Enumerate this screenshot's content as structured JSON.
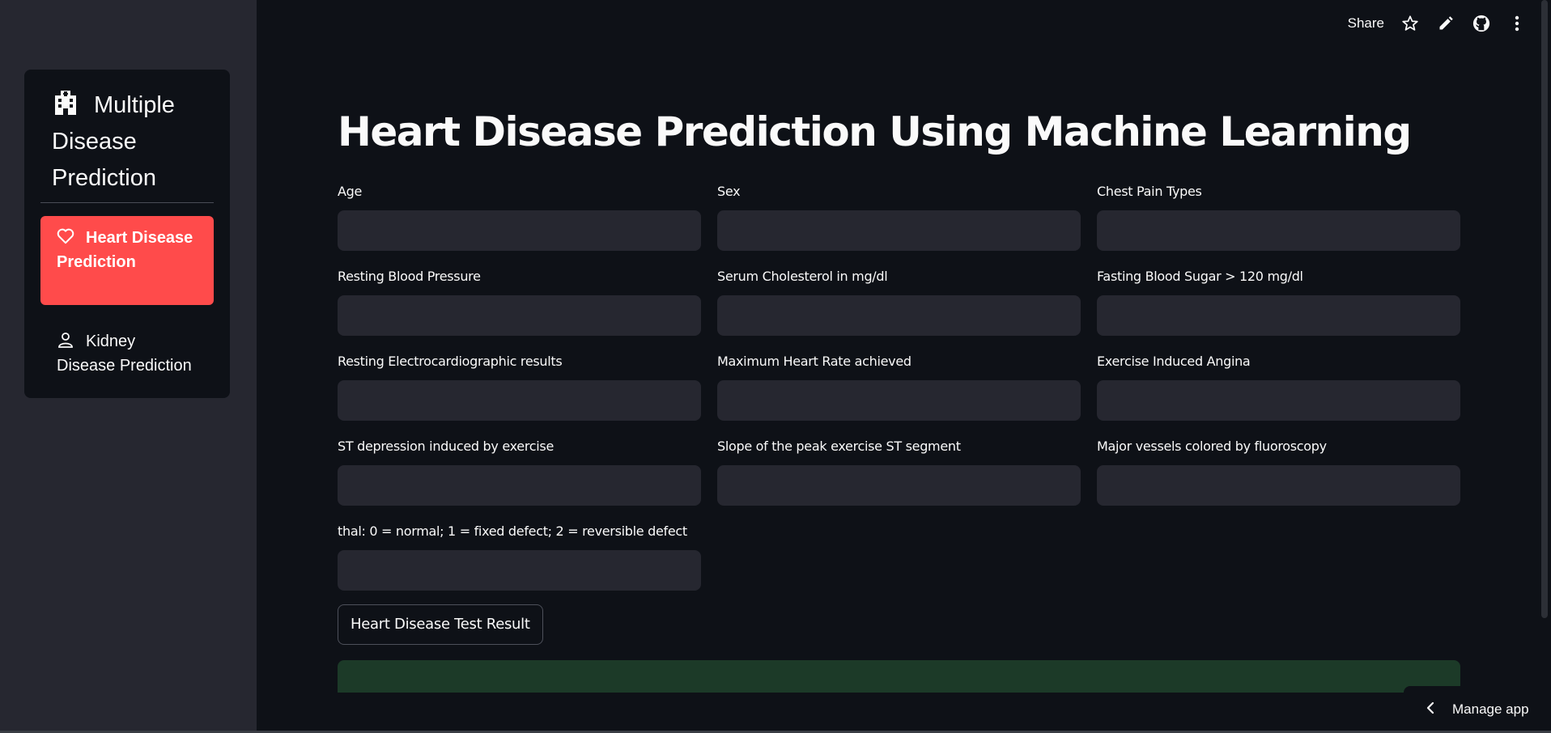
{
  "sidebar": {
    "menu_title": "Multiple Disease Prediction",
    "items": [
      {
        "label": "Heart Disease Prediction",
        "icon": "heart-icon",
        "active": true
      },
      {
        "label": "Kidney Disease Prediction",
        "icon": "person-icon",
        "active": false
      }
    ]
  },
  "toolbar": {
    "share_label": "Share",
    "icons": [
      "star-icon",
      "edit-icon",
      "github-icon",
      "more-icon"
    ]
  },
  "main": {
    "title": "Heart Disease Prediction Using Machine Learning",
    "fields": [
      {
        "label": "Age",
        "value": ""
      },
      {
        "label": "Sex",
        "value": ""
      },
      {
        "label": "Chest Pain Types",
        "value": ""
      },
      {
        "label": "Resting Blood Pressure",
        "value": ""
      },
      {
        "label": "Serum Cholesterol in mg/dl",
        "value": ""
      },
      {
        "label": "Fasting Blood Sugar > 120 mg/dl",
        "value": ""
      },
      {
        "label": "Resting Electrocardiographic results",
        "value": ""
      },
      {
        "label": "Maximum Heart Rate achieved",
        "value": ""
      },
      {
        "label": "Exercise Induced Angina",
        "value": ""
      },
      {
        "label": "ST depression induced by exercise",
        "value": ""
      },
      {
        "label": "Slope of the peak exercise ST segment",
        "value": ""
      },
      {
        "label": "Major vessels colored by fluoroscopy",
        "value": ""
      },
      {
        "label": "thal: 0 = normal; 1 = fixed defect; 2 = reversible defect",
        "value": ""
      }
    ],
    "result_button": "Heart Disease Test Result"
  },
  "footer": {
    "manage_app": "Manage app"
  },
  "colors": {
    "accent": "#ff4b4b",
    "background": "#0e1117",
    "sidebar": "#262730",
    "success_box": "#1c3a28"
  }
}
